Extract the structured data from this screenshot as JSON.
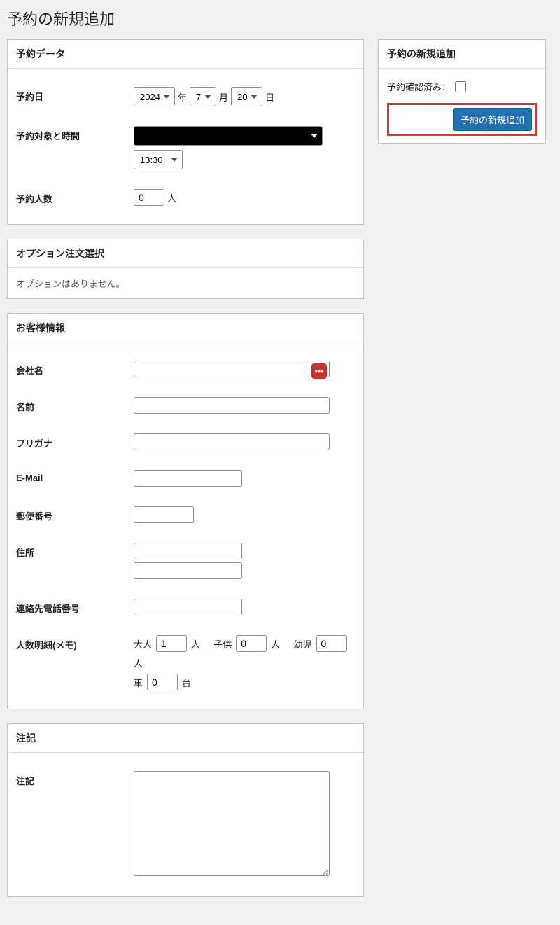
{
  "page_title": "予約の新規追加",
  "booking_data": {
    "section_title": "予約データ",
    "date_label": "予約日",
    "year_value": "2024",
    "year_unit": "年",
    "month_value": "7",
    "month_unit": "月",
    "day_value": "20",
    "day_unit": "日",
    "target_label": "予約対象と時間",
    "target_value": "",
    "time_value": "13:30",
    "people_label": "予約人数",
    "people_value": "0",
    "people_unit": "人"
  },
  "options": {
    "section_title": "オプション注文選択",
    "empty_text": "オプションはありません。"
  },
  "customer": {
    "section_title": "お客様情報",
    "company_label": "会社名",
    "name_label": "名前",
    "kana_label": "フリガナ",
    "email_label": "E-Mail",
    "postal_label": "郵便番号",
    "address_label": "住所",
    "phone_label": "連絡先電話番号",
    "detail_label": "人数明細(メモ)",
    "adult_label": "大人",
    "adult_value": "1",
    "adult_unit": "人",
    "child_label": "子供",
    "child_value": "0",
    "child_unit": "人",
    "infant_label": "幼児",
    "infant_value": "0",
    "infant_unit": "人",
    "car_label": "車",
    "car_value": "0",
    "car_unit": "台"
  },
  "notes": {
    "section_title": "注記",
    "note_label": "注記"
  },
  "side": {
    "section_title": "予約の新規追加",
    "confirmed_label": "予約確認済み：",
    "submit_label": "予約の新規追加"
  }
}
